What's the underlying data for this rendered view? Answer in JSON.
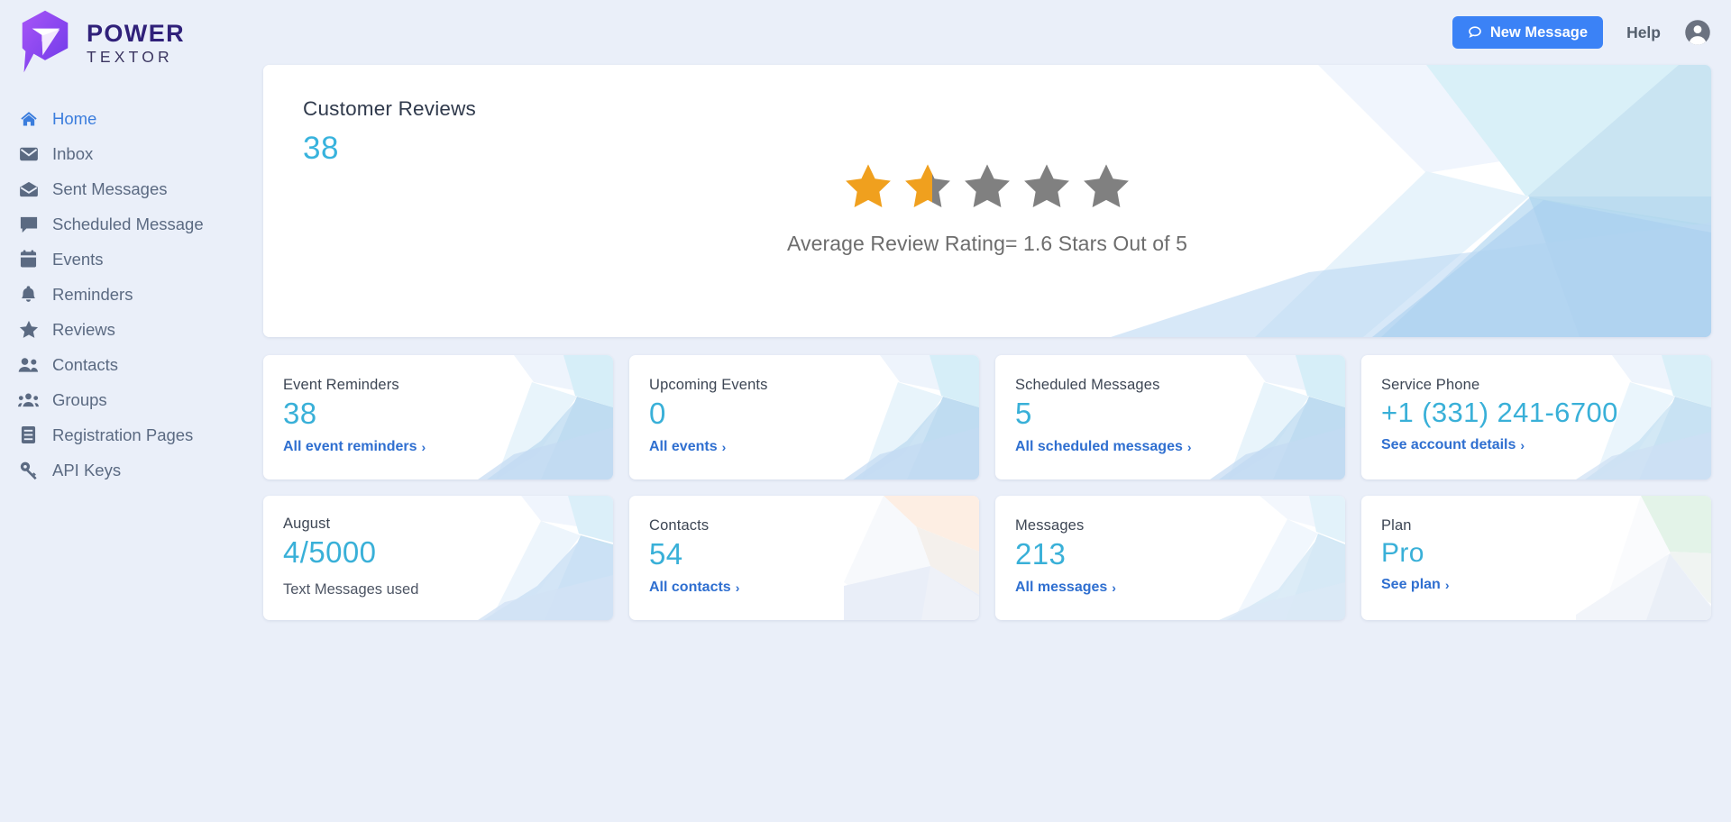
{
  "brand": {
    "name_line1": "POWER",
    "name_line2": "TEXTOR",
    "logo_icon": "power-textor-cube-logo",
    "logo_color_start": "#9a4ef5",
    "logo_color_end": "#6d3ae8"
  },
  "header": {
    "new_message_label": "New Message",
    "new_message_icon": "chat-bubble-icon",
    "new_message_color": "#3b82f6",
    "help_label": "Help",
    "account_icon": "account-circle-icon"
  },
  "sidebar": {
    "active_color": "#3b7ddd",
    "items": [
      {
        "label": "Home",
        "icon": "home-icon",
        "active": true
      },
      {
        "label": "Inbox",
        "icon": "envelope-icon",
        "active": false
      },
      {
        "label": "Sent Messages",
        "icon": "open-envelope-icon",
        "active": false
      },
      {
        "label": "Scheduled Message",
        "icon": "comment-icon",
        "active": false
      },
      {
        "label": "Events",
        "icon": "calendar-icon",
        "active": false
      },
      {
        "label": "Reminders",
        "icon": "bell-icon",
        "active": false
      },
      {
        "label": "Reviews",
        "icon": "star-icon",
        "active": false
      },
      {
        "label": "Contacts",
        "icon": "users-icon",
        "active": false
      },
      {
        "label": "Groups",
        "icon": "user-group-icon",
        "active": false
      },
      {
        "label": "Registration Pages",
        "icon": "list-document-icon",
        "active": false
      },
      {
        "label": "API Keys",
        "icon": "key-icon",
        "active": false
      }
    ]
  },
  "reviews": {
    "title": "Customer Reviews",
    "count": "38",
    "average_text": "Average Review Rating= 1.6 Stars Out of 5",
    "rating": 1.6,
    "max_rating": 5,
    "star_filled_color": "#f0a01e",
    "star_empty_color": "#808080"
  },
  "stats": {
    "row1": [
      {
        "label": "Event Reminders",
        "value": "38",
        "link": "All event reminders",
        "chevron": "›",
        "deco": "blue"
      },
      {
        "label": "Upcoming Events",
        "value": "0",
        "link": "All events",
        "chevron": "›",
        "deco": "blue"
      },
      {
        "label": "Scheduled Messages",
        "value": "5",
        "link": "All scheduled messages",
        "chevron": "›",
        "deco": "blue"
      },
      {
        "label": "Service Phone",
        "value": "+1 (331) 241-6700",
        "link": "See account details",
        "chevron": "›",
        "deco": "blue"
      }
    ],
    "row2": [
      {
        "label": "August",
        "value": "4/5000",
        "sub": "Text Messages used",
        "link": "",
        "chevron": "",
        "deco": "blue"
      },
      {
        "label": "Contacts",
        "value": "54",
        "sub": "",
        "link": "All contacts",
        "chevron": "›",
        "deco": "peach"
      },
      {
        "label": "Messages",
        "value": "213",
        "sub": "",
        "link": "All messages",
        "chevron": "›",
        "deco": "blue"
      },
      {
        "label": "Plan",
        "value": "Pro",
        "sub": "",
        "link": "See plan",
        "chevron": "›",
        "deco": "green"
      }
    ]
  },
  "colors": {
    "page_background": "#eaeff9",
    "card_background": "#ffffff",
    "accent_teal": "#39b0d8",
    "link_blue": "#2f6fd0"
  }
}
